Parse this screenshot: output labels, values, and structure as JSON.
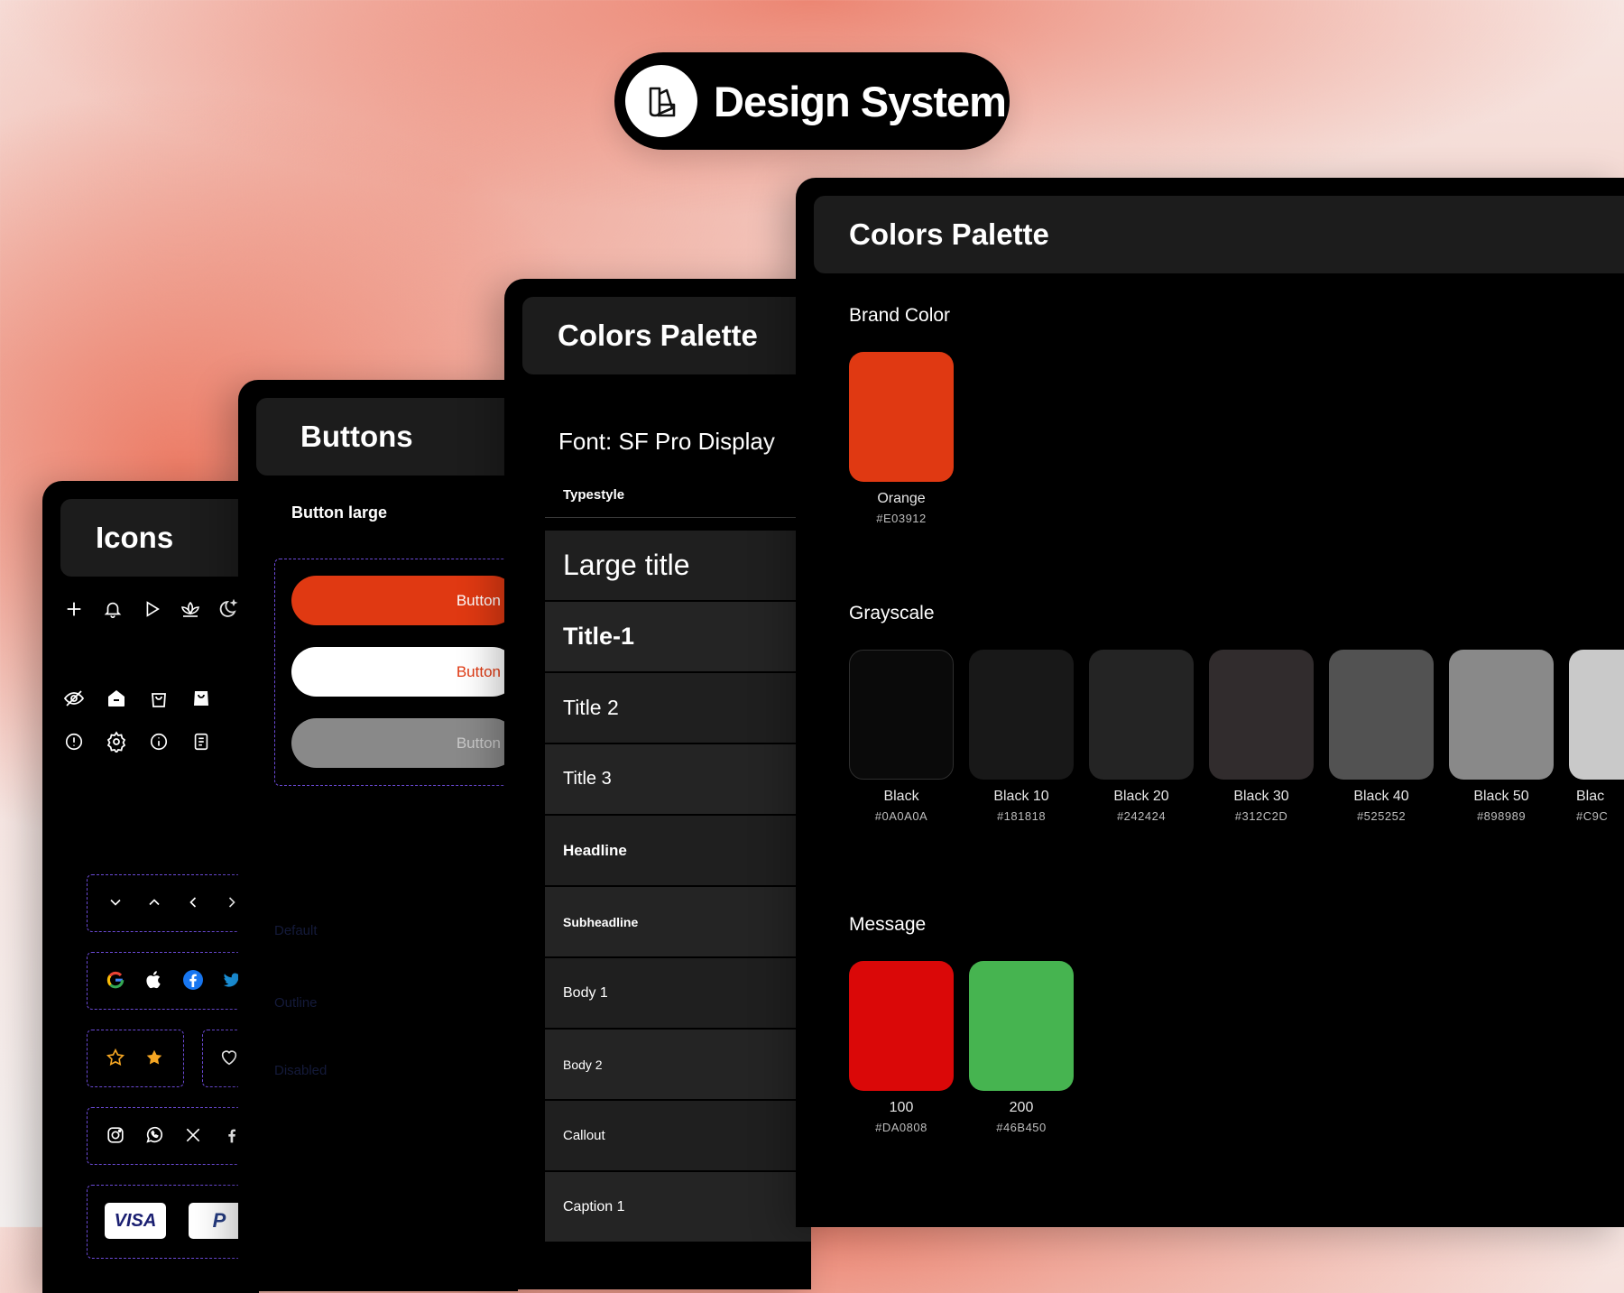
{
  "hero": {
    "title": "Design System"
  },
  "icons_card": {
    "title": "Icons",
    "row1": [
      "plus-icon",
      "bell-icon",
      "play-icon",
      "lotus-icon",
      "moon-icon"
    ],
    "row2": [
      "eye-off-icon",
      "home-icon",
      "bag-outline-icon",
      "bag-filled-icon"
    ],
    "row3": [
      "alert-circle-icon",
      "settings-icon",
      "info-icon",
      "document-icon"
    ],
    "chevrons": [
      "chevron-down-icon",
      "chevron-up-icon",
      "chevron-left-icon",
      "chevron-right-icon"
    ],
    "brands": [
      "google-icon",
      "apple-icon",
      "facebook-icon",
      "twitter-icon"
    ],
    "stars": [
      "star-outline-icon",
      "star-filled-icon"
    ],
    "socials": [
      "instagram-icon",
      "whatsapp-icon",
      "x-icon",
      "facebook-f-icon"
    ],
    "payments": {
      "visa": "VISA",
      "paypal": "P"
    },
    "colors": {
      "star": "#f5a623",
      "dash": "#6b4ad6",
      "google_blue": "#4285F4",
      "google_red": "#EA4335",
      "google_yellow": "#FBBC05",
      "google_green": "#34A853",
      "facebook": "#1877F2",
      "twitter": "#1DA1F2"
    }
  },
  "buttons_card": {
    "title": "Buttons",
    "subtitle": "Button large",
    "buttons": [
      {
        "label": "Button",
        "bg": "#E03912",
        "color": "#ffffff"
      },
      {
        "label": "Button",
        "bg": "#ffffff",
        "color": "#E03912"
      },
      {
        "label": "Button",
        "bg": "#898989",
        "color": "#c9c9c9"
      }
    ],
    "variants": [
      "Default",
      "Outline",
      "Disabled"
    ]
  },
  "type_card": {
    "title": "Colors Palette",
    "font": "Font: SF Pro Display",
    "typestyle_label": "Typestyle",
    "styles": [
      "Large title",
      "Title-1",
      "Title 2",
      "Title 3",
      "Headline",
      "Subheadline",
      "Body 1",
      "Body 2",
      "Callout",
      "Caption 1"
    ]
  },
  "colors_card": {
    "title": "Colors Palette",
    "brand": {
      "label": "Brand Color",
      "swatches": [
        {
          "name": "Orange",
          "hex": "#E03912",
          "color": "#E03912"
        }
      ]
    },
    "grayscale": {
      "label": "Grayscale",
      "swatches": [
        {
          "name": "Black",
          "hex": "#0A0A0A",
          "color": "#0A0A0A"
        },
        {
          "name": "Black 10",
          "hex": "#181818",
          "color": "#181818"
        },
        {
          "name": "Black 20",
          "hex": "#242424",
          "color": "#242424"
        },
        {
          "name": "Black 30",
          "hex": "#312C2D",
          "color": "#312C2D"
        },
        {
          "name": "Black 40",
          "hex": "#525252",
          "color": "#525252"
        },
        {
          "name": "Black 50",
          "hex": "#898989",
          "color": "#898989"
        },
        {
          "name": "Blac",
          "hex": "#C9C",
          "color": "#C9C9C9"
        }
      ]
    },
    "message": {
      "label": "Message",
      "swatches": [
        {
          "name": "100",
          "hex": "#DA0808",
          "color": "#DA0808"
        },
        {
          "name": "200",
          "hex": "#46B450",
          "color": "#46B450"
        }
      ]
    }
  }
}
